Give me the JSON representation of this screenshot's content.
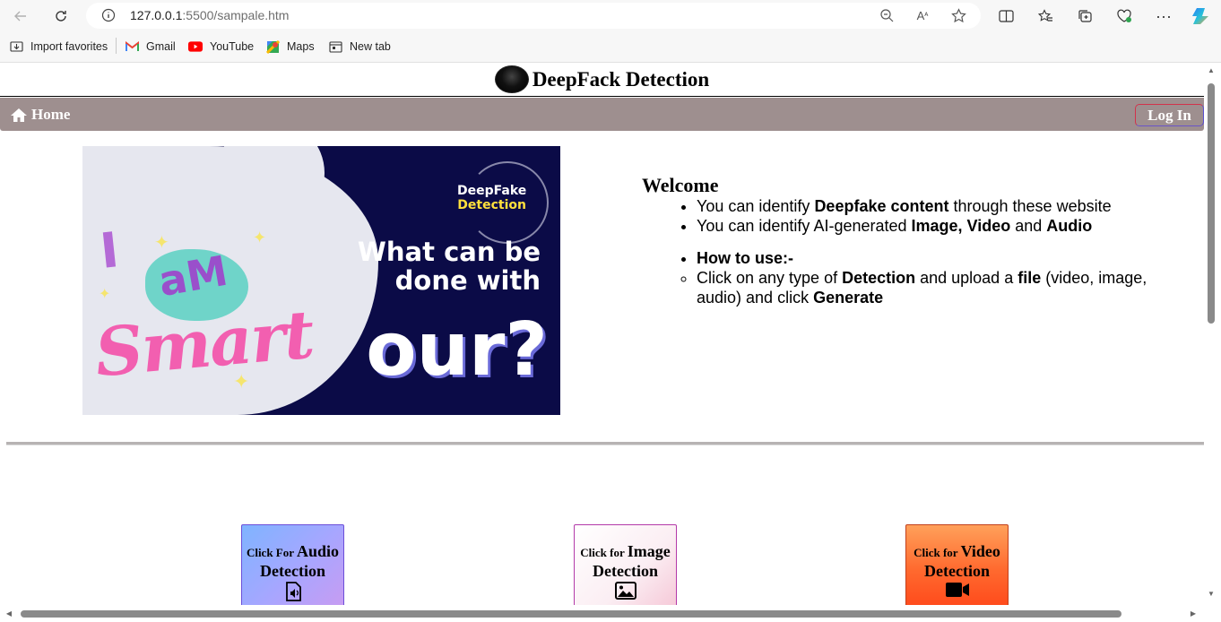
{
  "browser": {
    "url_host": "127.0.0.1",
    "url_path": ":5500/sampale.htm",
    "favorites": [
      {
        "label": "Import favorites",
        "icon": "import-icon"
      },
      {
        "label": "Gmail",
        "icon": "gmail-icon"
      },
      {
        "label": "YouTube",
        "icon": "youtube-icon"
      },
      {
        "label": "Maps",
        "icon": "maps-icon"
      },
      {
        "label": "New tab",
        "icon": "new-tab-icon"
      }
    ]
  },
  "site": {
    "title": "DeepFack Detection",
    "nav": {
      "home_label": "Home",
      "login_label": "Log In"
    }
  },
  "banner": {
    "i_am": "I",
    "am": "aM",
    "smart": "Smart",
    "brand_line1": "DeepFake",
    "brand_line2": "Detection",
    "question_line1": "What can be",
    "question_line2": "done with",
    "question_big": "our?"
  },
  "welcome": {
    "title": "Welcome",
    "bullet1": {
      "pre": "You can identify ",
      "bold": "Deepfake content",
      "post": " through these website"
    },
    "bullet2": {
      "pre": "You can identify AI-generated ",
      "bold1": "Image, Video",
      "mid": " and ",
      "bold2": "Audio"
    },
    "howto": "How to use:-",
    "step": {
      "pre": "Click on any type of ",
      "b1": "Detection",
      "m1": " and upload a ",
      "b2": "file",
      "m2": " (video, image, audio) and click ",
      "b3": "Generate"
    }
  },
  "cards": {
    "audio": {
      "small": "Click For ",
      "big": "Audio",
      "line2": "Detection"
    },
    "image": {
      "small": "Click for ",
      "big": "Image",
      "line2": "Detection"
    },
    "video": {
      "small": "Click for ",
      "big": "Video",
      "line2": "Detection"
    }
  },
  "colors": {
    "navbar": "#9e8f8f",
    "banner_bg": "#0b0b47",
    "audio_card": "#a7a6ff",
    "image_card": "#fbeef3",
    "video_card": "#ff6a2f"
  }
}
